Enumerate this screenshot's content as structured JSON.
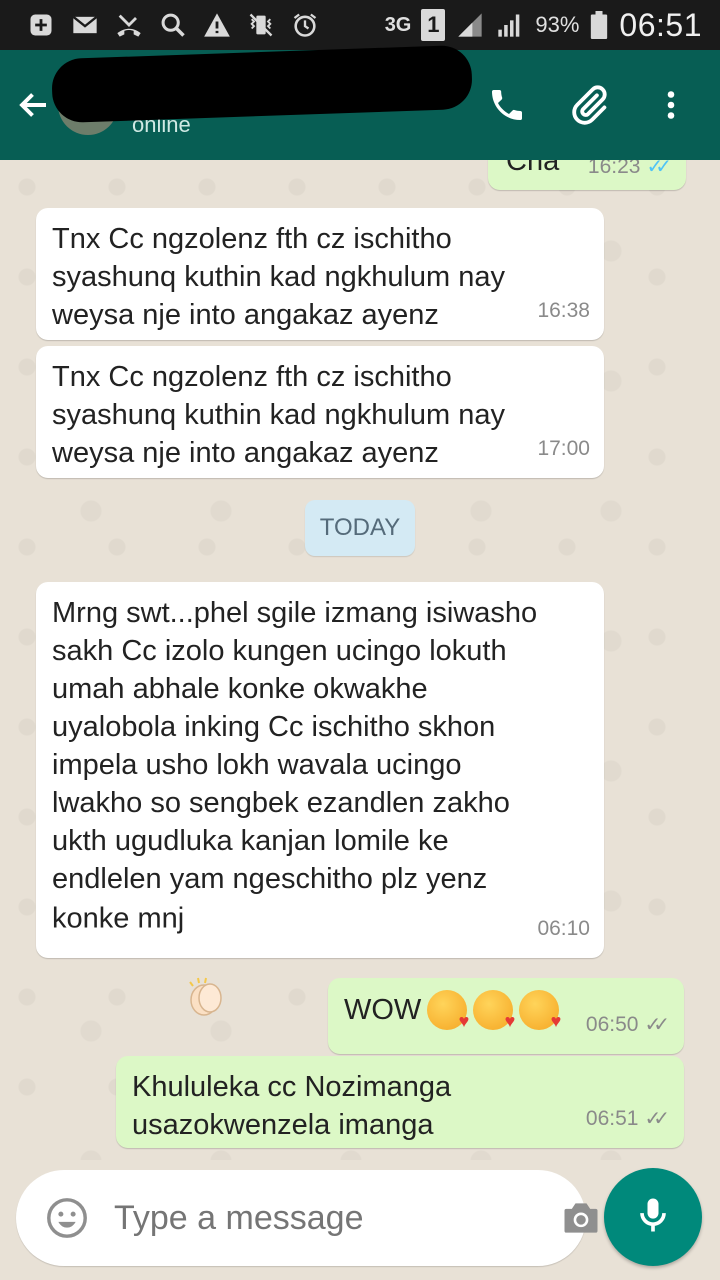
{
  "status_bar": {
    "battery": "93%",
    "time": "06:51",
    "network": "3G",
    "sim": "1",
    "icons": [
      "add-notification-icon",
      "mail-icon",
      "missed-call-icon",
      "search-icon",
      "warning-icon",
      "vibrate-icon",
      "alarm-icon",
      "signal-icon",
      "battery-icon"
    ]
  },
  "header": {
    "contact_name": "",
    "contact_status": "online",
    "actions": [
      "call-icon",
      "attach-icon",
      "more-icon"
    ]
  },
  "messages": [
    {
      "dir": "out",
      "text": "Cha",
      "time": "16:23",
      "ticks": "read"
    },
    {
      "dir": "in",
      "text": "Tnx Cc ngzolenz fth cz ischitho\nsyashunq kuthin kad ngkhulum nay\nweysa nje into angakaz ayenz",
      "time": "16:38"
    },
    {
      "dir": "in",
      "text": "Tnx Cc ngzolenz fth cz ischitho\nsyashunq kuthin kad ngkhulum nay\nweysa nje into angakaz ayenz",
      "time": "17:00"
    },
    {
      "dir": "in",
      "text": "Mrng swt...phel sgile izmang isiwasho\nsakh Cc izolo kungen ucingo lokuth\numah abhale konke okwakhe\nuyalobola inking Cc ischitho skhon\nimpela usho lokh wavala ucingo\nlwakho so sengbek ezandlen zakho\nukth ugudluka kanjan lomile ke\nendlelen yam ngeschitho plz yenz\nkonke mnj",
      "time": "06:10"
    },
    {
      "dir": "out",
      "text": "WOW",
      "time": "06:50",
      "ticks": "delivered"
    },
    {
      "dir": "out",
      "text": "Khululeka cc Nozimanga\nusazokwenzela imanga",
      "time": "06:51",
      "ticks": "delivered"
    }
  ],
  "date_separator": "TODAY",
  "composer": {
    "placeholder": "Type a message"
  },
  "colors": {
    "header": "#075e54",
    "outgoing_bubble": "#dcf8c6",
    "incoming_bubble": "#ffffff",
    "mic_button": "#00897b",
    "read_ticks": "#4fc3f7"
  }
}
